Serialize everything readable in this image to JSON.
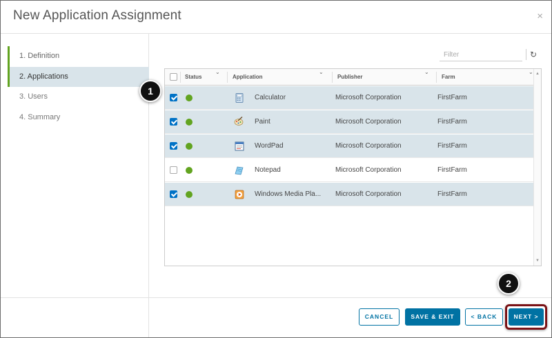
{
  "dialog": {
    "title": "New Application Assignment",
    "close_glyph": "×"
  },
  "steps": [
    {
      "label": "1. Definition",
      "state": "done"
    },
    {
      "label": "2. Applications",
      "state": "active"
    },
    {
      "label": "3. Users",
      "state": "todo"
    },
    {
      "label": "4. Summary",
      "state": "todo"
    }
  ],
  "toolbar": {
    "filter_placeholder": "Filter",
    "refresh_glyph": "↻"
  },
  "grid": {
    "columns": [
      "Status",
      "Application",
      "Publisher",
      "Farm"
    ],
    "rows": [
      {
        "checked": true,
        "status": "available",
        "app": "Calculator",
        "icon": "calculator-icon",
        "publisher": "Microsoft Corporation",
        "farm": "FirstFarm"
      },
      {
        "checked": true,
        "status": "available",
        "app": "Paint",
        "icon": "paint-icon",
        "publisher": "Microsoft Corporation",
        "farm": "FirstFarm"
      },
      {
        "checked": true,
        "status": "available",
        "app": "WordPad",
        "icon": "wordpad-icon",
        "publisher": "Microsoft Corporation",
        "farm": "FirstFarm"
      },
      {
        "checked": false,
        "status": "available",
        "app": "Notepad",
        "icon": "notepad-icon",
        "publisher": "Microsoft Corporation",
        "farm": "FirstFarm"
      },
      {
        "checked": true,
        "status": "available",
        "app": "Windows Media Pla...",
        "icon": "media-player-icon",
        "publisher": "Microsoft Corporation",
        "farm": "FirstFarm"
      }
    ]
  },
  "footer": {
    "cancel_label": "CANCEL",
    "save_exit_label": "SAVE & EXIT",
    "back_label": "< BACK",
    "next_label": "NEXT >"
  },
  "callouts": [
    "1",
    "2"
  ],
  "colors": {
    "accent": "#0072a3",
    "selected_row": "#d9e4ea",
    "status_green": "#62a420",
    "step_marker": "#62a420",
    "highlight_border": "#7a1216"
  }
}
